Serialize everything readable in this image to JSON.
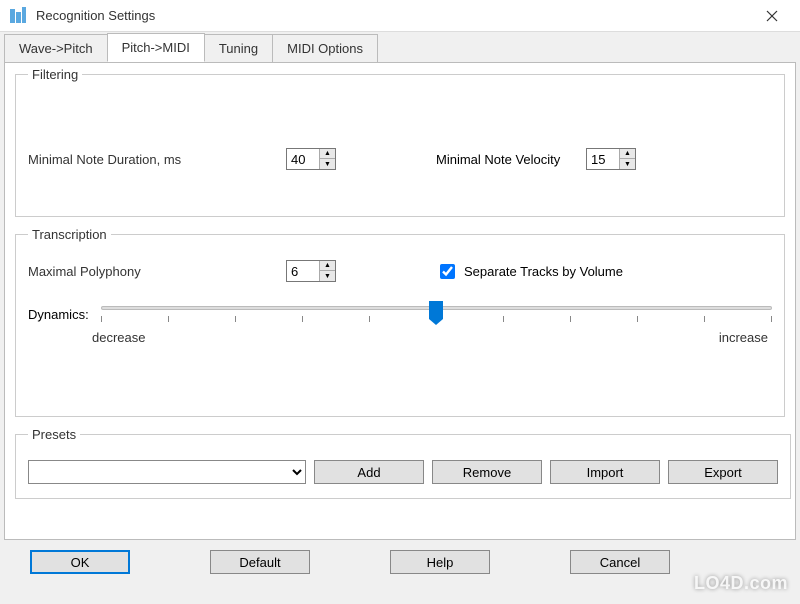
{
  "window": {
    "title": "Recognition Settings"
  },
  "tabs": {
    "wave_pitch": "Wave->Pitch",
    "pitch_midi": "Pitch->MIDI",
    "tuning": "Tuning",
    "midi_options": "MIDI Options"
  },
  "filtering": {
    "legend": "Filtering",
    "min_duration_label": "Minimal Note Duration, ms",
    "min_duration_value": "40",
    "min_velocity_label": "Minimal Note Velocity",
    "min_velocity_value": "15"
  },
  "transcription": {
    "legend": "Transcription",
    "max_polyphony_label": "Maximal Polyphony",
    "max_polyphony_value": "6",
    "separate_tracks_label": "Separate Tracks by Volume",
    "separate_tracks_checked": true,
    "dynamics_label": "Dynamics:",
    "dynamics_min": "decrease",
    "dynamics_max": "increase"
  },
  "presets": {
    "legend": "Presets",
    "selected": "",
    "add": "Add",
    "remove": "Remove",
    "import": "Import",
    "export": "Export"
  },
  "buttons": {
    "ok": "OK",
    "default": "Default",
    "help": "Help",
    "cancel": "Cancel"
  },
  "watermark": "LO4D.com"
}
